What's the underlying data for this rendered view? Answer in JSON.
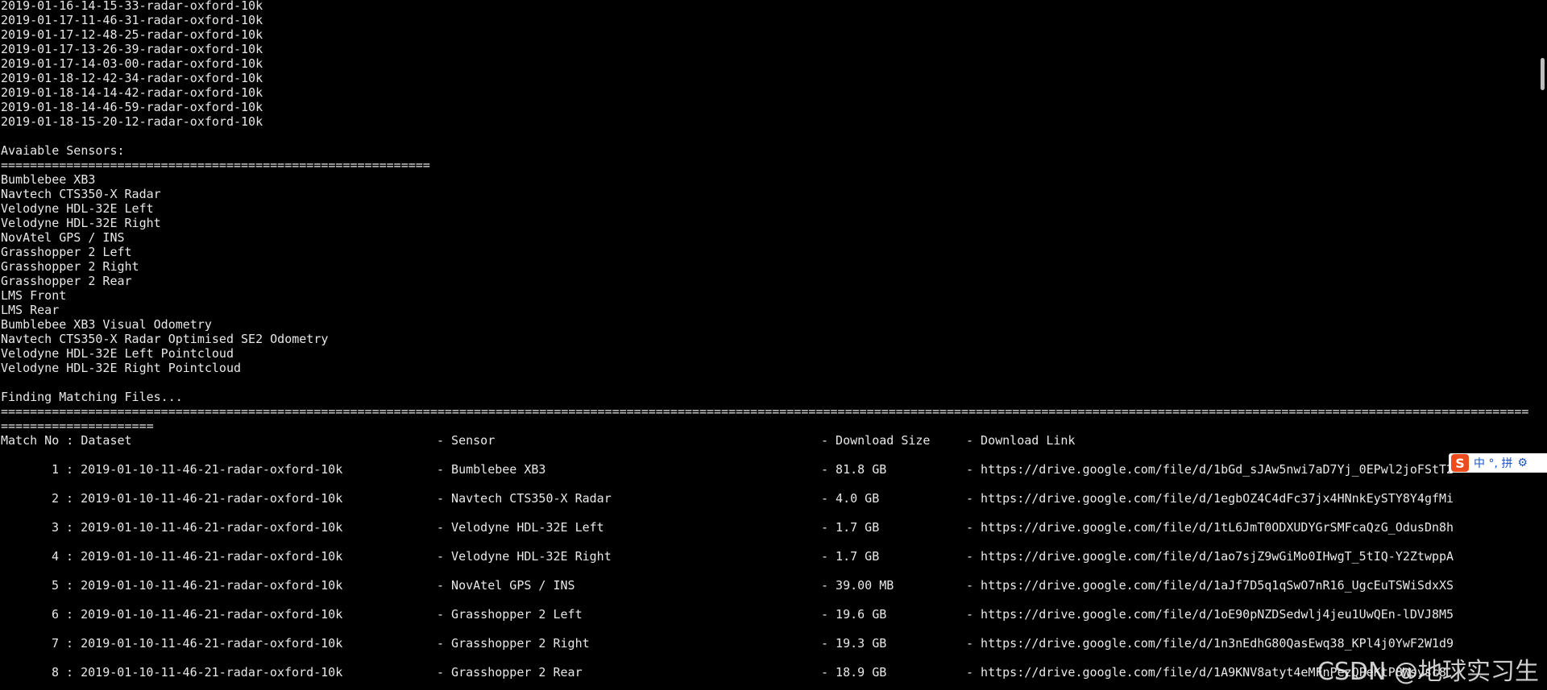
{
  "dataset_lines": [
    "2019-01-16-14-15-33-radar-oxford-10k",
    "2019-01-17-11-46-31-radar-oxford-10k",
    "2019-01-17-12-48-25-radar-oxford-10k",
    "2019-01-17-13-26-39-radar-oxford-10k",
    "2019-01-17-14-03-00-radar-oxford-10k",
    "2019-01-18-12-42-34-radar-oxford-10k",
    "2019-01-18-14-14-42-radar-oxford-10k",
    "2019-01-18-14-46-59-radar-oxford-10k",
    "2019-01-18-15-20-12-radar-oxford-10k"
  ],
  "sensors_heading": "Avaiable Sensors:",
  "sensors_separator": "===========================================================",
  "sensors": [
    "Bumblebee XB3",
    "Navtech CTS350-X Radar",
    "Velodyne HDL-32E Left",
    "Velodyne HDL-32E Right",
    "NovAtel GPS / INS",
    "Grasshopper 2 Left",
    "Grasshopper 2 Right",
    "Grasshopper 2 Rear",
    "LMS Front",
    "LMS Rear",
    "Bumblebee XB3 Visual Odometry",
    "Navtech CTS350-X Radar Optimised SE2 Odometry",
    "Velodyne HDL-32E Left Pointcloud",
    "Velodyne HDL-32E Right Pointcloud"
  ],
  "finding_heading": "Finding Matching Files...",
  "long_separator": "==================================================================================================================================================================================================================",
  "long_separator_wrap": "=====================",
  "table_header": {
    "match": "Match No : Dataset",
    "sensor": "- Sensor",
    "size": "- Download Size",
    "link": "- Download Link"
  },
  "rows": [
    {
      "no": "1 : 2019-01-10-11-46-21-radar-oxford-10k",
      "sensor": "- Bumblebee XB3",
      "size": "- 81.8 GB",
      "link": "- https://drive.google.com/file/d/1bGd_sJAw5nwi7aD7Yj_0EPwl2joFStT2"
    },
    {
      "no": "2 : 2019-01-10-11-46-21-radar-oxford-10k",
      "sensor": "- Navtech CTS350-X Radar",
      "size": "- 4.0 GB",
      "link": "- https://drive.google.com/file/d/1egbOZ4C4dFc37jx4HNnkEySTY8Y4gfMi"
    },
    {
      "no": "3 : 2019-01-10-11-46-21-radar-oxford-10k",
      "sensor": "- Velodyne HDL-32E Left",
      "size": "- 1.7 GB",
      "link": "- https://drive.google.com/file/d/1tL6JmT0ODXUDYGrSMFcaQzG_OdusDn8h"
    },
    {
      "no": "4 : 2019-01-10-11-46-21-radar-oxford-10k",
      "sensor": "- Velodyne HDL-32E Right",
      "size": "- 1.7 GB",
      "link": "- https://drive.google.com/file/d/1ao7sjZ9wGiMo0IHwgT_5tIQ-Y2ZtwppA"
    },
    {
      "no": "5 : 2019-01-10-11-46-21-radar-oxford-10k",
      "sensor": "- NovAtel GPS / INS",
      "size": "- 39.00 MB",
      "link": "- https://drive.google.com/file/d/1aJf7D5q1qSwO7nR16_UgcEuTSWiSdxXS"
    },
    {
      "no": "6 : 2019-01-10-11-46-21-radar-oxford-10k",
      "sensor": "- Grasshopper 2 Left",
      "size": "- 19.6 GB",
      "link": "- https://drive.google.com/file/d/1oE90pNZDSedwlj4jeu1UwQEn-lDVJ8M5"
    },
    {
      "no": "7 : 2019-01-10-11-46-21-radar-oxford-10k",
      "sensor": "- Grasshopper 2 Right",
      "size": "- 19.3 GB",
      "link": "- https://drive.google.com/file/d/1n3nEdhG80QasEwq38_KPl4j0YwF2W1d9"
    },
    {
      "no": "8 : 2019-01-10-11-46-21-radar-oxford-10k",
      "sensor": "- Grasshopper 2 Rear",
      "size": "- 18.9 GB",
      "link": "- https://drive.google.com/file/d/1A9KNV8atyt4eMFnPezQPeKtP8Wsysc8"
    }
  ],
  "ime": {
    "label": "中 °, 拼",
    "logo_letter": "S",
    "settings_icon": "gear-icon"
  },
  "watermark": "CSDN @地球实习生"
}
